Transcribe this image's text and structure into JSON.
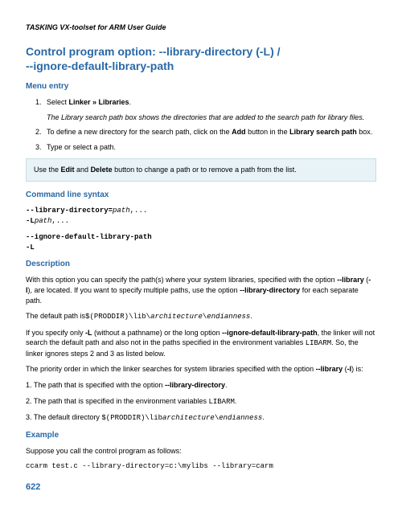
{
  "header": "TASKING VX-toolset for ARM User Guide",
  "title_line1": "Control program option: --library-directory (-L) /",
  "title_line2": "--ignore-default-library-path",
  "menu_heading": "Menu entry",
  "step1_pre": "Select ",
  "step1_bold": "Linker » Libraries",
  "step1_post": ".",
  "step1_note": "The Library search path box shows the directories that are added to the search path for library files.",
  "step2_a": "To define a new directory for the search path, click on the ",
  "step2_b": "Add",
  "step2_c": " button in the ",
  "step2_d": "Library search path",
  "step2_e": " box.",
  "step3": "Type or select a path.",
  "infobox_a": "Use the ",
  "infobox_b": "Edit",
  "infobox_c": " and ",
  "infobox_d": "Delete",
  "infobox_e": " button to change a path or to remove a path from the list.",
  "cli_heading": "Command line syntax",
  "cli1_a": "--library-directory=",
  "cli1_b": "path",
  "cli1_c": ",...",
  "cli2_a": "-L",
  "cli2_b": "path",
  "cli2_c": ",...",
  "cli3": "--ignore-default-library-path",
  "cli4": "-L",
  "desc_heading": "Description",
  "desc_p1_a": "With this option you can specify the path(s) where your system libraries, specified with the option ",
  "desc_p1_b": "--library",
  "desc_p1_c": " (",
  "desc_p1_d": "-l",
  "desc_p1_e": "), are located. If you want to specify multiple paths, use the option ",
  "desc_p1_f": "--library-directory",
  "desc_p1_g": " for each separate path.",
  "desc_p2_a": "The default path is",
  "desc_p2_b": "$(PRODDIR)\\lib\\",
  "desc_p2_c": "architecture",
  "desc_p2_d": "\\",
  "desc_p2_e": "endianness",
  "desc_p2_f": ".",
  "desc_p3_a": "If you specify only ",
  "desc_p3_b": "-L",
  "desc_p3_c": " (without a pathname) or the long option ",
  "desc_p3_d": "--ignore-default-library-path",
  "desc_p3_e": ", the linker will not search the default path and also not in the paths specified in the environment variables ",
  "desc_p3_f": "LIBARM",
  "desc_p3_g": ". So, the linker ignores steps 2 and 3 as listed below.",
  "desc_p4_a": "The priority order in which the linker searches for system libraries specified with the option ",
  "desc_p4_b": "--library",
  "desc_p4_c": " (",
  "desc_p4_d": "-l",
  "desc_p4_e": ") is:",
  "pri1_a": "1. The path that is specified with the option ",
  "pri1_b": "--library-directory",
  "pri1_c": ".",
  "pri2_a": "2. The path that is specified in the environment variables ",
  "pri2_b": "LIBARM",
  "pri2_c": ".",
  "pri3_a": "3. The default directory ",
  "pri3_b": "$(PRODDIR)\\lib",
  "pri3_c": "architecture",
  "pri3_d": "\\",
  "pri3_e": "endianness",
  "pri3_f": ".",
  "example_heading": "Example",
  "ex_p1": "Suppose you call the control program as follows:",
  "ex_code": "ccarm test.c --library-directory=c:\\mylibs --library=carm",
  "page_num": "622"
}
